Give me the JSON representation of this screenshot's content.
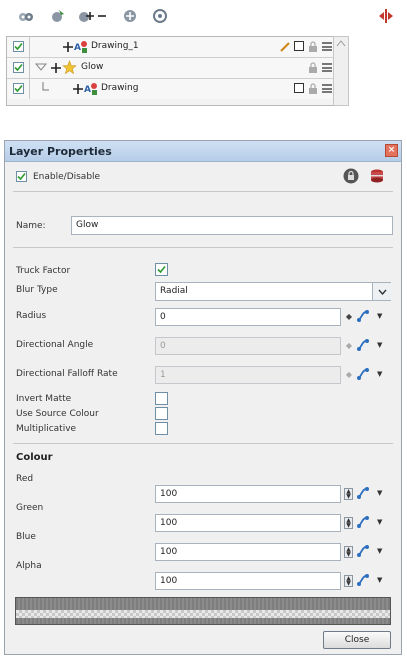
{
  "timeline": {
    "layers": [
      {
        "name": "Drawing_1",
        "enabled": true
      },
      {
        "name": "Glow",
        "enabled": true
      },
      {
        "name": "Drawing",
        "enabled": true
      }
    ]
  },
  "dialog": {
    "title": "Layer Properties",
    "close_glyph": "×",
    "enable_label": "Enable/Disable",
    "enabled": true,
    "name_label": "Name:",
    "name_value": "Glow",
    "truck_factor_label": "Truck Factor",
    "truck_factor": true,
    "blur_type_label": "Blur Type",
    "blur_type_value": "Radial",
    "radius_label": "Radius",
    "radius_value": "0",
    "directional_angle_label": "Directional Angle",
    "directional_angle_value": "0",
    "falloff_label": "Directional Falloff Rate",
    "falloff_value": "1",
    "invert_matte_label": "Invert Matte",
    "invert_matte": false,
    "use_source_colour_label": "Use Source Colour",
    "use_source_colour": false,
    "multiplicative_label": "Multiplicative",
    "multiplicative": false,
    "colour_header": "Colour",
    "colour": [
      {
        "label": "Red",
        "value": "100"
      },
      {
        "label": "Green",
        "value": "100"
      },
      {
        "label": "Blue",
        "value": "100"
      },
      {
        "label": "Alpha",
        "value": "100"
      }
    ],
    "close_button": "Close"
  },
  "colors": {
    "accent": "#2f9a2f",
    "title_bar": "#b6cde8",
    "close": "#e4735e"
  },
  "icons": [
    "layer-props-icon",
    "add-layer-icon",
    "add-remove-icon",
    "duplicate-icon",
    "transform-icon",
    "split-icon",
    "pencil-icon",
    "lock-icon",
    "menu-icon",
    "star-icon",
    "sphere-icon",
    "function-icon"
  ]
}
